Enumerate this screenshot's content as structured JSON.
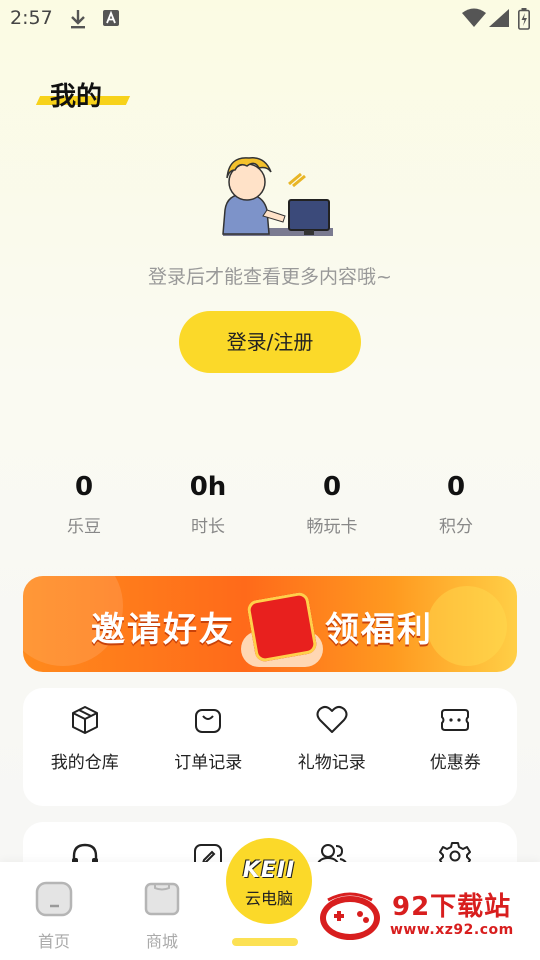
{
  "status_bar": {
    "time": "2:57"
  },
  "header": {
    "title": "我的"
  },
  "login": {
    "hint": "登录后才能查看更多内容哦~",
    "button": "登录/注册"
  },
  "stats": [
    {
      "value": "0",
      "label": "乐豆"
    },
    {
      "value": "0h",
      "label": "时长"
    },
    {
      "value": "0",
      "label": "畅玩卡"
    },
    {
      "value": "0",
      "label": "积分"
    }
  ],
  "banner": {
    "left_text": "邀请好友",
    "right_text": "领福利"
  },
  "quick_actions": [
    {
      "label": "我的仓库",
      "icon": "box-icon"
    },
    {
      "label": "订单记录",
      "icon": "bag-icon"
    },
    {
      "label": "礼物记录",
      "icon": "heart-icon"
    },
    {
      "label": "优惠券",
      "icon": "ticket-icon"
    }
  ],
  "more_actions": [
    {
      "icon": "headset-icon"
    },
    {
      "icon": "edit-icon"
    },
    {
      "icon": "users-icon"
    },
    {
      "icon": "gear-icon"
    }
  ],
  "bottom_nav": {
    "home": "首页",
    "store": "商城",
    "cloud_pc": "云电脑",
    "cloud_pc_logo": "KEII"
  },
  "watermark": {
    "title": "92下载站",
    "url": "www.xz92.com"
  }
}
